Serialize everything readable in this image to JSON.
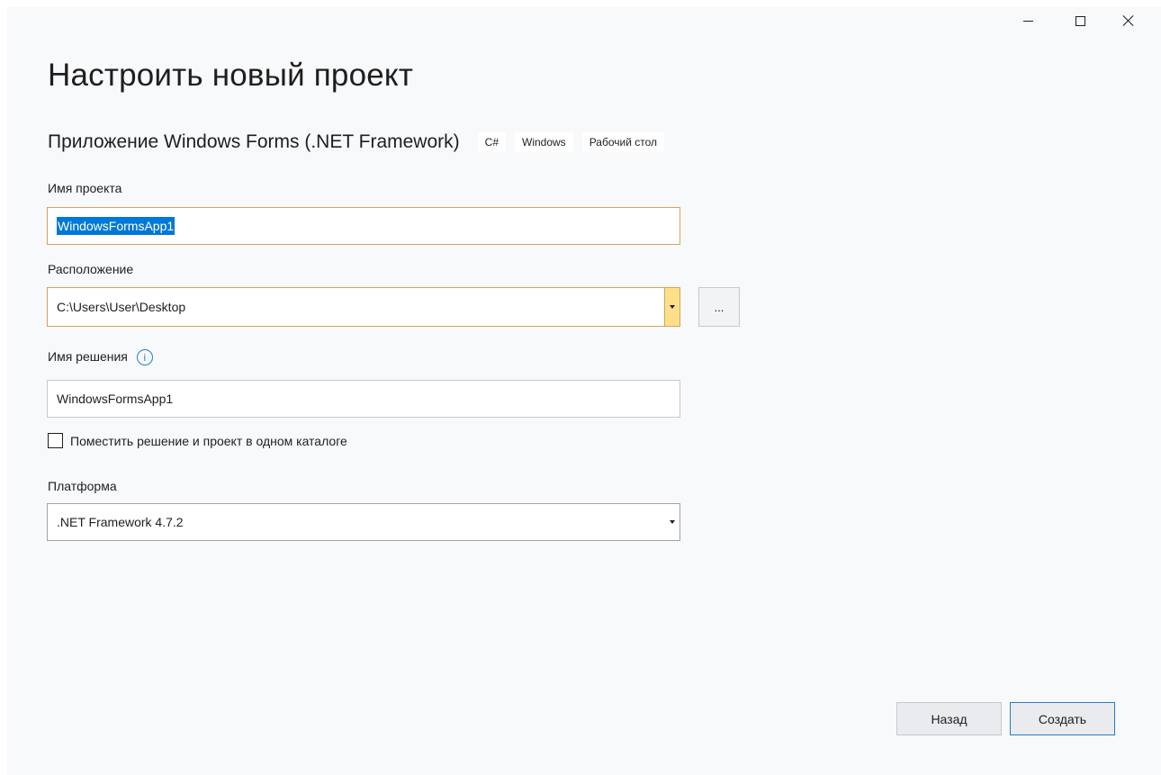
{
  "window": {
    "controls": {
      "minimize": "minimize-icon",
      "maximize": "maximize-icon",
      "close": "close-icon"
    }
  },
  "header": {
    "title": "Настроить новый проект",
    "template_name": "Приложение Windows Forms (.NET Framework)",
    "tags": [
      "C#",
      "Windows",
      "Рабочий стол"
    ]
  },
  "form": {
    "project_name": {
      "label": "Имя проекта",
      "value": "WindowsFormsApp1"
    },
    "location": {
      "label": "Расположение",
      "value": "C:\\Users\\User\\Desktop",
      "browse_label": "..."
    },
    "solution_name": {
      "label": "Имя решения",
      "info_icon": "info-icon",
      "value": "WindowsFormsApp1"
    },
    "same_directory": {
      "label": "Поместить решение и проект в одном каталоге",
      "checked": false
    },
    "framework": {
      "label": "Платформа",
      "value": ".NET Framework 4.7.2"
    }
  },
  "footer": {
    "back_label": "Назад",
    "create_label": "Создать"
  },
  "colors": {
    "background": "#f8f9fb",
    "accent": "#0078d7",
    "focus_border": "#d4a35e"
  }
}
